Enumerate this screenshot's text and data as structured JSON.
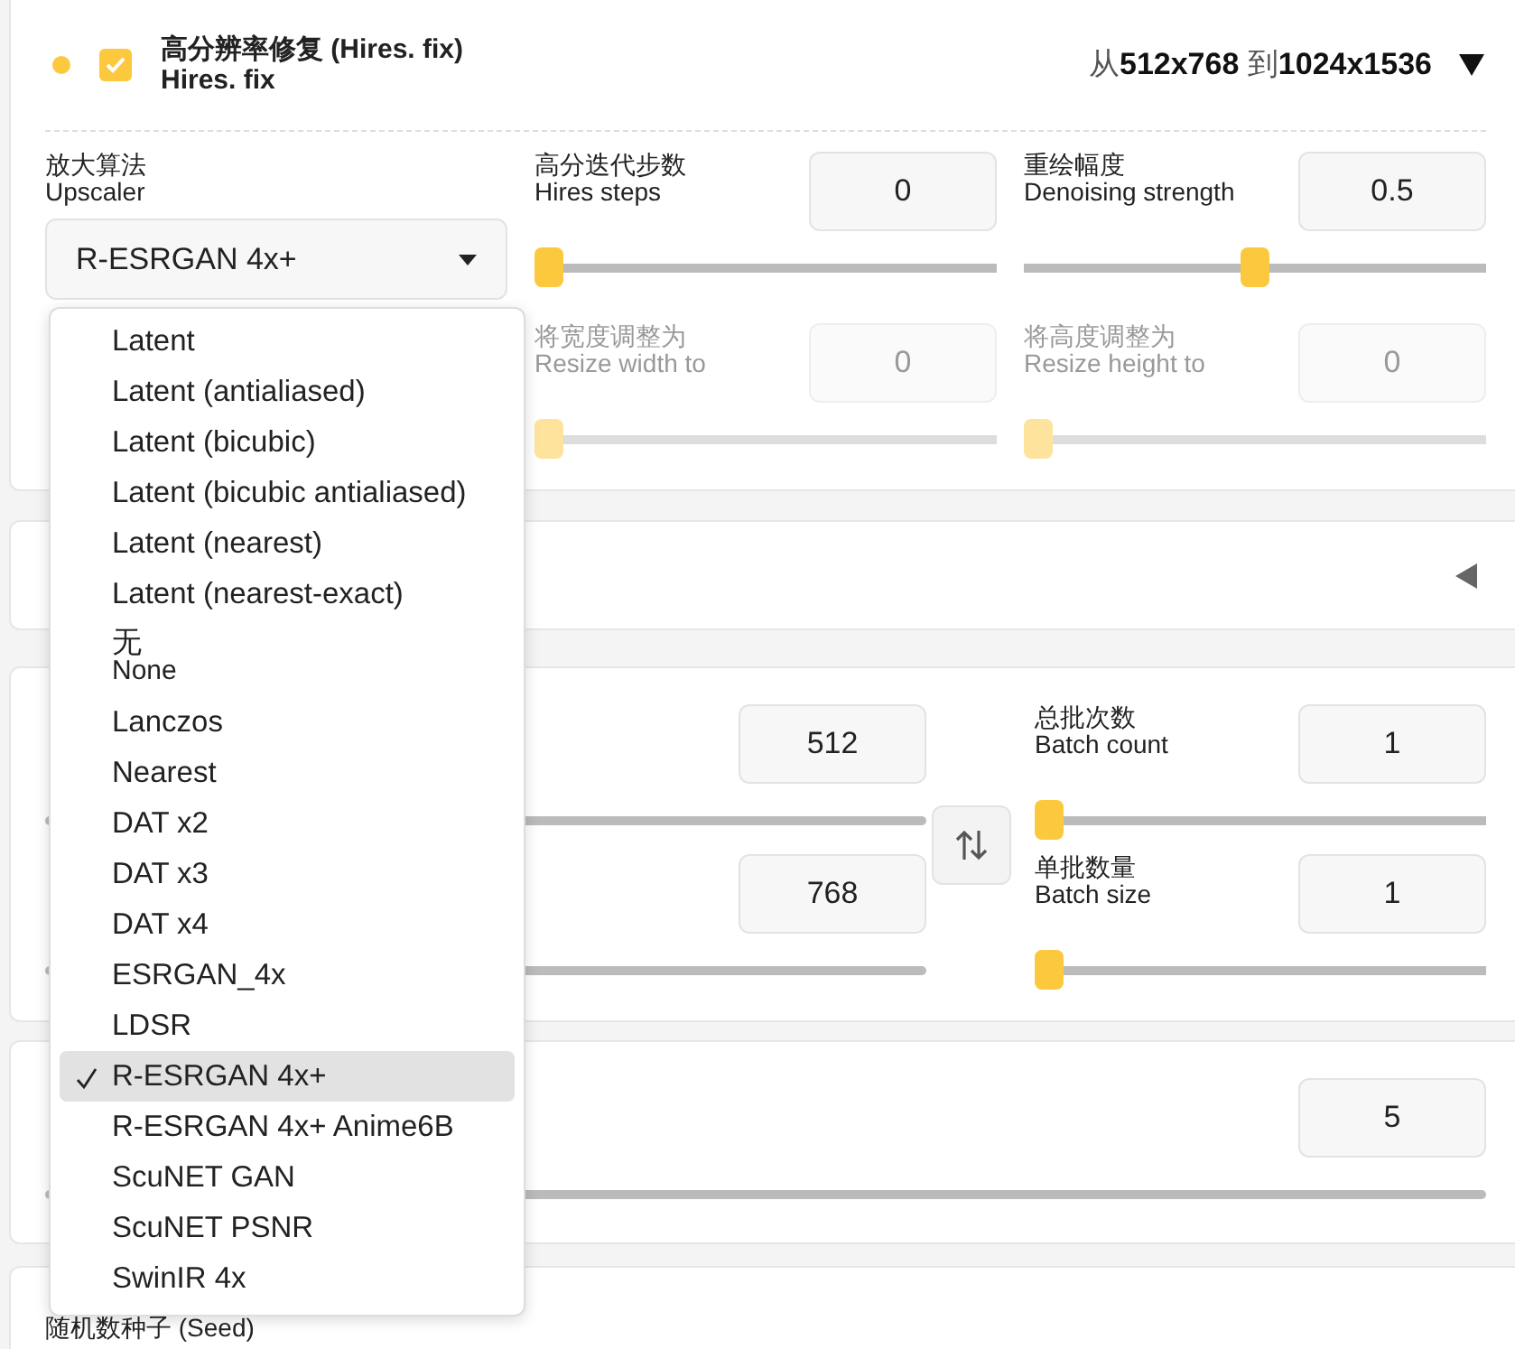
{
  "hires_fix": {
    "enabled": true,
    "title": "高分辨率修复 (Hires. fix)",
    "subtitle": "Hires. fix",
    "summary": "从**512x768** 到**1024x1536**",
    "upscaler": {
      "label": "放大算法",
      "sublabel": "Upscaler",
      "value": "R-ESRGAN 4x+"
    },
    "controls": [
      {
        "label": "高分迭代步数",
        "sublabel": "Hires steps",
        "value": "0",
        "level": 0,
        "disabled": false
      },
      {
        "label": "重绘幅度",
        "sublabel": "Denoising strength",
        "value": "0.5",
        "level": 0.5,
        "disabled": false
      },
      {
        "label": "将宽度调整为",
        "sublabel": "Resize width to",
        "value": "0",
        "level": 0,
        "disabled": true
      },
      {
        "label": "将高度调整为",
        "sublabel": "Resize height to",
        "value": "0",
        "level": 0,
        "disabled": true
      }
    ]
  },
  "collapsed_panel": {
    "expanded": false
  },
  "size_panel": {
    "size_values": [
      "512",
      "768"
    ],
    "batch": [
      {
        "label": "总批次数",
        "sublabel": "Batch count",
        "value": "1",
        "level": 0
      },
      {
        "label": "单批数量",
        "sublabel": "Batch size",
        "value": "1",
        "level": 0
      }
    ]
  },
  "steps_panel": {
    "value": "5"
  },
  "seed_panel": {
    "label": "随机数种子 (Seed)"
  },
  "upscaler_menu": {
    "items": [
      {
        "label": "Latent",
        "selected": false
      },
      {
        "label": "Latent (antialiased)",
        "selected": false
      },
      {
        "label": "Latent (bicubic)",
        "selected": false
      },
      {
        "label": "Latent (bicubic antialiased)",
        "selected": false
      },
      {
        "label": "Latent (nearest)",
        "selected": false
      },
      {
        "label": "Latent (nearest-exact)",
        "selected": false
      },
      {
        "label": "无",
        "sublabel": "None",
        "selected": false
      },
      {
        "label": "Lanczos",
        "selected": false
      },
      {
        "label": "Nearest",
        "selected": false
      },
      {
        "label": "DAT x2",
        "selected": false
      },
      {
        "label": "DAT x3",
        "selected": false
      },
      {
        "label": "DAT x4",
        "selected": false
      },
      {
        "label": "ESRGAN_4x",
        "selected": false
      },
      {
        "label": "LDSR",
        "selected": false
      },
      {
        "label": "R-ESRGAN 4x+",
        "selected": true
      },
      {
        "label": "R-ESRGAN 4x+ Anime6B",
        "selected": false
      },
      {
        "label": "ScuNET GAN",
        "selected": false
      },
      {
        "label": "ScuNET PSNR",
        "selected": false
      },
      {
        "label": "SwinIR 4x",
        "selected": false
      }
    ]
  }
}
